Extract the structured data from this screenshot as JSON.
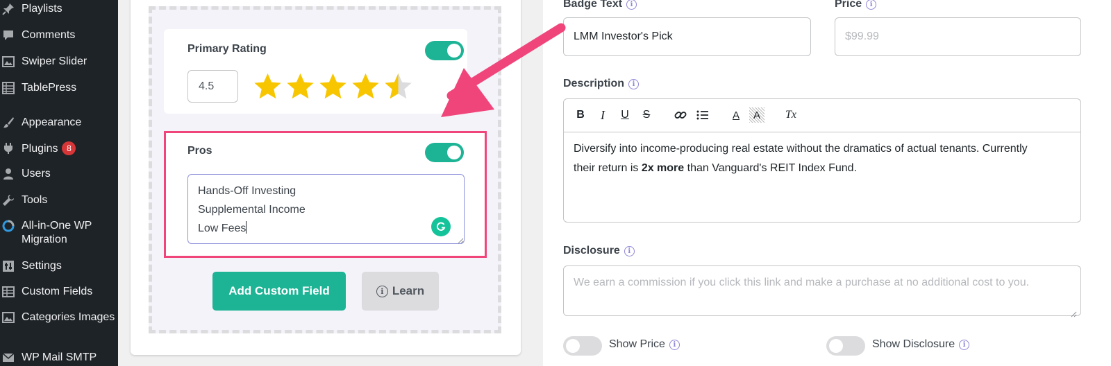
{
  "sidebar": {
    "items": [
      {
        "label": "Playlists",
        "icon": "pin-icon"
      },
      {
        "label": "Comments",
        "icon": "comment-icon"
      },
      {
        "label": "Swiper Slider",
        "icon": "slider-icon"
      },
      {
        "label": "TablePress",
        "icon": "table-icon"
      },
      {
        "label": "Appearance",
        "icon": "paintbrush-icon"
      },
      {
        "label": "Plugins",
        "icon": "plugin-icon",
        "badge": "8"
      },
      {
        "label": "Users",
        "icon": "user-icon"
      },
      {
        "label": "Tools",
        "icon": "wrench-icon"
      },
      {
        "label": "All-in-One WP Migration",
        "icon": "migration-icon"
      },
      {
        "label": "Settings",
        "icon": "settings-icon"
      },
      {
        "label": "Custom Fields",
        "icon": "custom-fields-icon"
      },
      {
        "label": "Categories Images",
        "icon": "image-icon"
      },
      {
        "label": "WP Mail SMTP",
        "icon": "mail-icon"
      }
    ]
  },
  "left": {
    "rating": {
      "title": "Primary Rating",
      "value": "4.5",
      "stars_filled": 4.5,
      "stars_total": 5,
      "enabled": true
    },
    "pros": {
      "title": "Pros",
      "enabled": true,
      "lines": [
        "Hands-Off Investing",
        "Supplemental Income",
        "Low Fees"
      ]
    },
    "add_button": "Add Custom Field",
    "learn_button": "Learn"
  },
  "right": {
    "badge_label": "Badge Text",
    "badge_value": "LMM Investor's Pick",
    "price_label": "Price",
    "price_placeholder": "$99.99",
    "description_label": "Description",
    "description_text_1": "Diversify into income-producing real estate without the dramatics of actual tenants. Currently",
    "description_text_2a": "their return is ",
    "description_bold": "2x more",
    "description_text_2b": " than Vanguard's REIT Index Fund.",
    "disclosure_label": "Disclosure",
    "disclosure_placeholder": "We earn a commission if you click this link and make a purchase at no additional cost to you.",
    "show_price_label": "Show Price",
    "show_disclosure_label": "Show Disclosure",
    "toolbar": {
      "bold": "B",
      "italic": "I",
      "underline": "U",
      "strike": "S",
      "clear": "Tx",
      "text_color": "A",
      "bg_color": "A"
    }
  },
  "colors": {
    "accent": "#1db496",
    "annotation": "#f0457a",
    "badge": "#d63638",
    "star": "#f7c600"
  }
}
